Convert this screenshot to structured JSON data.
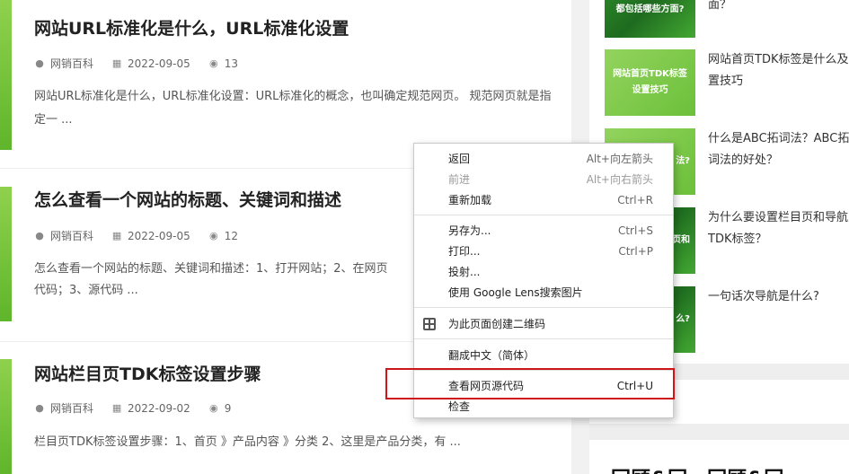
{
  "articles": [
    {
      "title": "网站URL标准化是什么，URL标准化设置",
      "author": "网销百科",
      "date": "2022-09-05",
      "views": "13",
      "excerpt": "网站URL标准化是什么，URL标准化设置：URL标准化的概念，也叫确定规范网页。 规范网页就是指定一 ..."
    },
    {
      "title": "怎么查看一个网站的标题、关键词和描述",
      "author": "网销百科",
      "date": "2022-09-05",
      "views": "12",
      "excerpt": "怎么查看一个网站的标题、关键词和描述：1、打开网站；2、在网页",
      "excerpt2": "代码；3、源代码 ..."
    },
    {
      "title": "网站栏目页TDK标签设置步骤",
      "author": "网销百科",
      "date": "2022-09-02",
      "views": "9",
      "excerpt": "栏目页TDK标签设置步骤：1、首页 》产品内容 》分类  2、这里是产品分类，有 ..."
    }
  ],
  "sidebar": {
    "items": [
      {
        "thumb_text": "都包括哪些方面?",
        "text": "面？"
      },
      {
        "thumb_text": "网站首页TDK标签设置技巧",
        "text": "网站首页TDK标签是什么及设置技巧"
      },
      {
        "thumb_text": "法?",
        "text": "什么是ABC拓词法？ABC拓词法的好处？"
      },
      {
        "thumb_text": "页和",
        "text": "为什么要设置栏目页和导航页TDK标签？"
      },
      {
        "thumb_text": "么?",
        "text": "一句话次导航是什么?"
      }
    ],
    "bottom_title": "回顾&回一回顾&回"
  },
  "context_menu": {
    "groups": [
      [
        {
          "label": "返回",
          "shortcut": "Alt+向左箭头",
          "disabled": false
        },
        {
          "label": "前进",
          "shortcut": "Alt+向右箭头",
          "disabled": true
        },
        {
          "label": "重新加载",
          "shortcut": "Ctrl+R",
          "disabled": false
        }
      ],
      [
        {
          "label": "另存为...",
          "shortcut": "Ctrl+S",
          "disabled": false
        },
        {
          "label": "打印...",
          "shortcut": "Ctrl+P",
          "disabled": false
        },
        {
          "label": "投射...",
          "shortcut": "",
          "disabled": false
        },
        {
          "label": "使用 Google Lens搜索图片",
          "shortcut": "",
          "disabled": false
        }
      ],
      [
        {
          "label": "为此页面创建二维码",
          "shortcut": "",
          "disabled": false,
          "icon": "qr-code-icon"
        }
      ],
      [
        {
          "label": "翻成中文（简体）",
          "shortcut": "",
          "disabled": false
        }
      ],
      [
        {
          "label": "查看网页源代码",
          "shortcut": "Ctrl+U",
          "disabled": false,
          "highlighted": true
        },
        {
          "label": "检查",
          "shortcut": "",
          "disabled": false
        }
      ]
    ]
  },
  "colors": {
    "highlight_border": "#d0151a",
    "thumb_green": "#5fb52b"
  }
}
